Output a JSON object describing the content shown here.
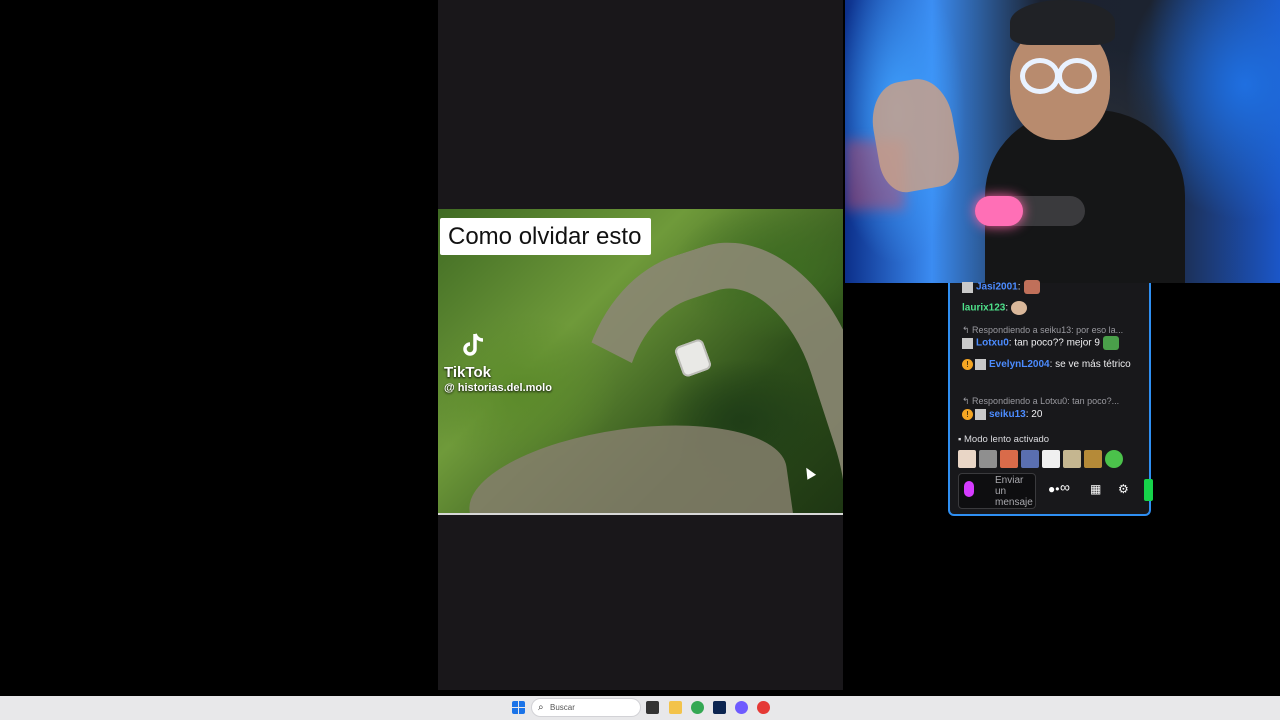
{
  "video": {
    "caption": "Como olvidar esto",
    "watermark_brand": "TikTok",
    "watermark_handle": "@ historias.del.molo"
  },
  "chat": {
    "messages": [
      {
        "user": "Jasi2001",
        "text": ":"
      },
      {
        "user": "laurix123",
        "text": ":"
      },
      {
        "reply_hint": "Respondiendo a seiku13: por eso la...",
        "user": "Lotxu0",
        "text": ": tan poco?? mejor 9"
      },
      {
        "user": "EvelynL2004",
        "text": ": se ve más tétrico"
      },
      {
        "reply_hint": "Respondiendo a Lotxu0: tan poco?...",
        "user": "seiku13",
        "text": ": 20"
      }
    ],
    "slow_mode": "Modo lento activado",
    "input_placeholder": "Enviar un mensaje",
    "infinity": "∞",
    "accent_color": "#2f8ff2"
  },
  "taskbar": {
    "search_placeholder": "Buscar"
  }
}
